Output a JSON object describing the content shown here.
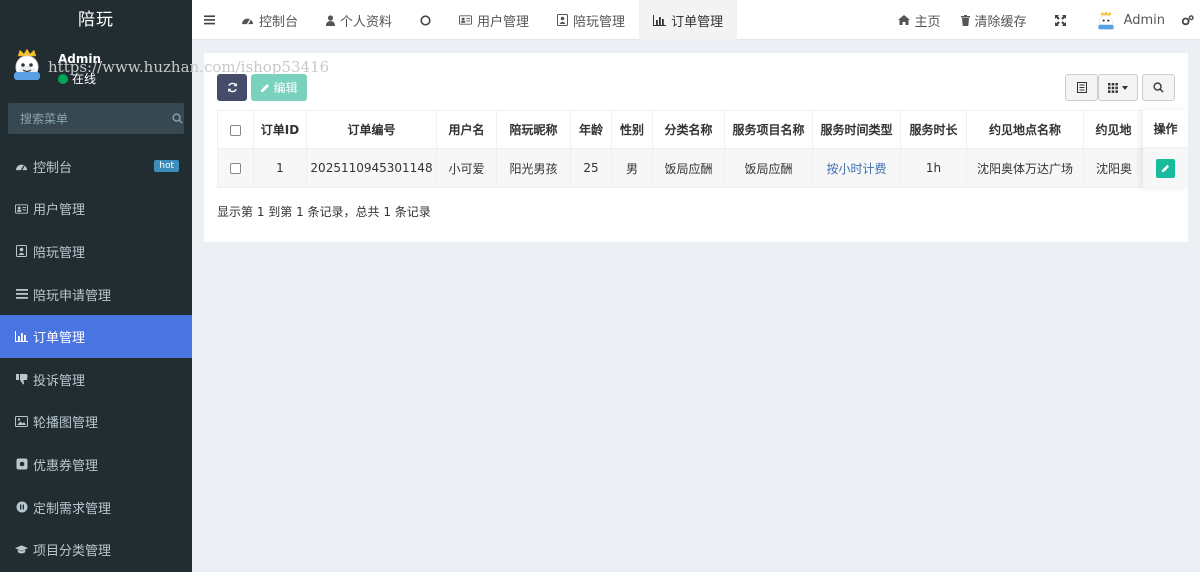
{
  "app": {
    "brand": "陪玩"
  },
  "user": {
    "name": "Admin",
    "status": "在线"
  },
  "watermark": "https://www.huzhan.com/ishop53416",
  "sidebar": {
    "search_placeholder": "搜索菜单",
    "items": [
      {
        "label": "控制台",
        "icon": "dashboard-icon",
        "badge": "hot"
      },
      {
        "label": "用户管理",
        "icon": "id-card-icon"
      },
      {
        "label": "陪玩管理",
        "icon": "portrait-icon"
      },
      {
        "label": "陪玩申请管理",
        "icon": "bars-icon"
      },
      {
        "label": "订单管理",
        "icon": "bar-chart-icon",
        "active": true
      },
      {
        "label": "投诉管理",
        "icon": "thumbs-down-icon"
      },
      {
        "label": "轮播图管理",
        "icon": "image-icon"
      },
      {
        "label": "优惠券管理",
        "icon": "coupon-icon"
      },
      {
        "label": "定制需求管理",
        "icon": "pause-circle-icon"
      },
      {
        "label": "项目分类管理",
        "icon": "graduation-cap-icon"
      }
    ]
  },
  "topnav": {
    "tabs": [
      {
        "label": "控制台",
        "icon": "dashboard-icon"
      },
      {
        "label": "个人资料",
        "icon": "user-icon"
      },
      {
        "label": "",
        "icon": "circle-icon"
      },
      {
        "label": "用户管理",
        "icon": "id-card-icon"
      },
      {
        "label": "陪玩管理",
        "icon": "portrait-icon"
      },
      {
        "label": "订单管理",
        "icon": "bar-chart-icon",
        "active": true
      }
    ],
    "right": {
      "home": "主页",
      "clear_cache": "清除缓存",
      "admin": "Admin"
    }
  },
  "toolbar": {
    "edit_label": "编辑"
  },
  "table": {
    "columns": [
      "订单ID",
      "订单编号",
      "用户名",
      "陪玩昵称",
      "年龄",
      "性别",
      "分类名称",
      "服务项目名称",
      "服务时间类型",
      "服务时长",
      "约见地点名称",
      "约见地"
    ],
    "rows": [
      [
        "1",
        "2025110945301148",
        "小可爱",
        "阳光男孩",
        "25",
        "男",
        "饭局应酬",
        "饭局应酬",
        "按小时计费",
        "1h",
        "沈阳奥体万达广场",
        "沈阳奥"
      ]
    ],
    "op_header": "操作"
  },
  "pagination": {
    "summary": "显示第 1 到第 1 条记录，总共 1 条记录"
  },
  "colors": {
    "sidebar_bg": "#222d32",
    "active_menu": "#4a74e0",
    "refresh_btn": "#444c69",
    "edit_btn": "#79d2bd",
    "op_btn": "#18bc9c"
  }
}
